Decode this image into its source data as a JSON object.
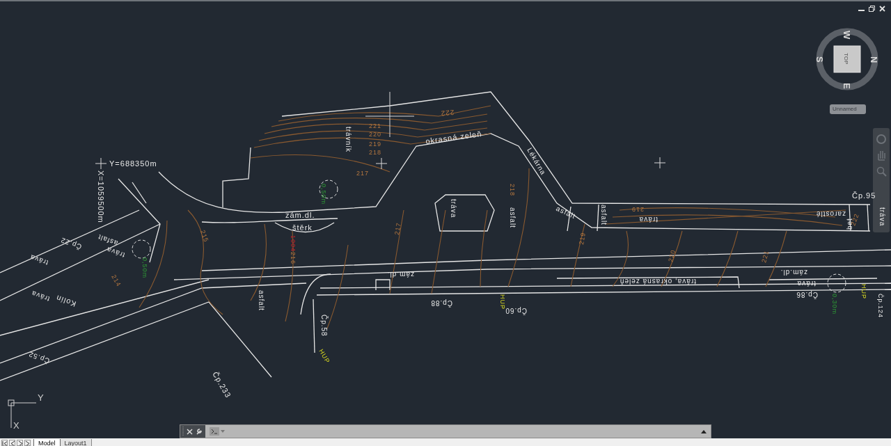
{
  "drawing": {
    "labels": [
      {
        "text": "Y=688350m",
        "kind": "coordinate"
      },
      {
        "text": "X=1059500m",
        "kind": "coordinate"
      },
      {
        "text": "trávník",
        "kind": "label"
      },
      {
        "text": "okrasná zeleň",
        "kind": "label"
      },
      {
        "text": "Lékárna",
        "kind": "label"
      },
      {
        "text": "zám.dl.",
        "kind": "label"
      },
      {
        "text": "štěrk",
        "kind": "label"
      },
      {
        "text": "tráva",
        "kind": "label"
      },
      {
        "text": "asfalt",
        "kind": "label"
      },
      {
        "text": "asfalt",
        "kind": "label"
      },
      {
        "text": "asfalt",
        "kind": "label"
      },
      {
        "text": "tráva",
        "kind": "label"
      },
      {
        "text": "zarostlé",
        "kind": "label"
      },
      {
        "text": "bet",
        "kind": "label"
      },
      {
        "text": "Čp.95",
        "kind": "label"
      },
      {
        "text": "tráva",
        "kind": "label"
      },
      {
        "text": "zám.dl.",
        "kind": "label"
      },
      {
        "text": "tráva, okrasná zeleň",
        "kind": "label"
      },
      {
        "text": "zám.dl.",
        "kind": "label"
      },
      {
        "text": "tráva",
        "kind": "label"
      },
      {
        "text": "Čp.86",
        "kind": "label"
      },
      {
        "text": "Čp.88",
        "kind": "label"
      },
      {
        "text": "Čp.60",
        "kind": "label"
      },
      {
        "text": "HUP",
        "kind": "utility"
      },
      {
        "text": "HUP",
        "kind": "utility"
      },
      {
        "text": "0,30m",
        "kind": "dimension"
      },
      {
        "text": "Čp.124",
        "kind": "label"
      },
      {
        "text": "0,50m",
        "kind": "dimension"
      },
      {
        "text": "0,50m",
        "kind": "dimension"
      },
      {
        "text": "1004",
        "kind": "marker"
      },
      {
        "text": "asfalt",
        "kind": "label"
      },
      {
        "text": "Kolín",
        "kind": "label"
      },
      {
        "text": "tráva",
        "kind": "label"
      },
      {
        "text": "tráva",
        "kind": "label"
      },
      {
        "text": "asfalt",
        "kind": "label"
      },
      {
        "text": "tráva",
        "kind": "label"
      },
      {
        "text": "Čp.22",
        "kind": "label"
      },
      {
        "text": "Čp.52",
        "kind": "label"
      },
      {
        "text": "Čp.233",
        "kind": "label"
      },
      {
        "text": "Čp.58",
        "kind": "label"
      },
      {
        "text": "HUP",
        "kind": "utility"
      },
      {
        "text": "222",
        "kind": "contour"
      },
      {
        "text": "221",
        "kind": "contour"
      },
      {
        "text": "220",
        "kind": "contour"
      },
      {
        "text": "219",
        "kind": "contour"
      },
      {
        "text": "218",
        "kind": "contour"
      },
      {
        "text": "217",
        "kind": "contour"
      },
      {
        "text": "218",
        "kind": "contour"
      },
      {
        "text": "217",
        "kind": "contour"
      },
      {
        "text": "216",
        "kind": "contour"
      },
      {
        "text": "215",
        "kind": "contour"
      },
      {
        "text": "214",
        "kind": "contour"
      },
      {
        "text": "219",
        "kind": "contour"
      },
      {
        "text": "219",
        "kind": "contour"
      },
      {
        "text": "220",
        "kind": "contour"
      },
      {
        "text": "221",
        "kind": "contour"
      },
      {
        "text": "222",
        "kind": "contour"
      }
    ]
  },
  "ucs": {
    "x": "X",
    "y": "Y"
  },
  "viewcube": {
    "face": "TOP",
    "directions": [
      "W",
      "N",
      "E",
      "S"
    ],
    "view_name": "Unnamed"
  },
  "layout_tabs": [
    {
      "label": "Model",
      "selected": true
    },
    {
      "label": "Layout1",
      "selected": false
    }
  ]
}
